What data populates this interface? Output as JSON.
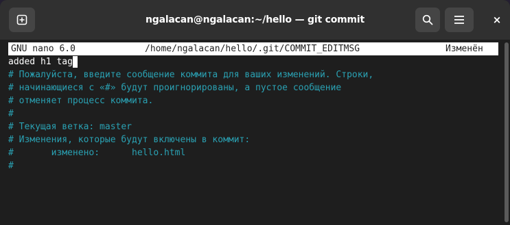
{
  "window": {
    "title": "ngalacan@ngalacan:~/hello — git commit",
    "new_tab_icon": "new-tab-icon",
    "search_icon": "search-icon",
    "menu_icon": "hamburger-menu-icon",
    "close_label": "×"
  },
  "nano": {
    "version": "GNU nano 6.0",
    "file_path": "/home/ngalacan/hello/.git/COMMIT_EDITMSG",
    "status": "Изменён"
  },
  "editor": {
    "commit_message": "added h1 tag",
    "comment_lines": [
      "# Пожалуйста, введите сообщение коммита для ваших изменений. Строки,",
      "# начинающиеся с «#» будут проигнорированы, а пустое сообщение",
      "# отменяет процесс коммита.",
      "#",
      "# Текущая ветка: master",
      "# Изменения, которые будут включены в коммит:",
      "#       изменено:      hello.html",
      "#"
    ]
  },
  "colors": {
    "comment": "#2aa1b3",
    "background": "#1e1e1e",
    "titlebar": "#303030"
  }
}
